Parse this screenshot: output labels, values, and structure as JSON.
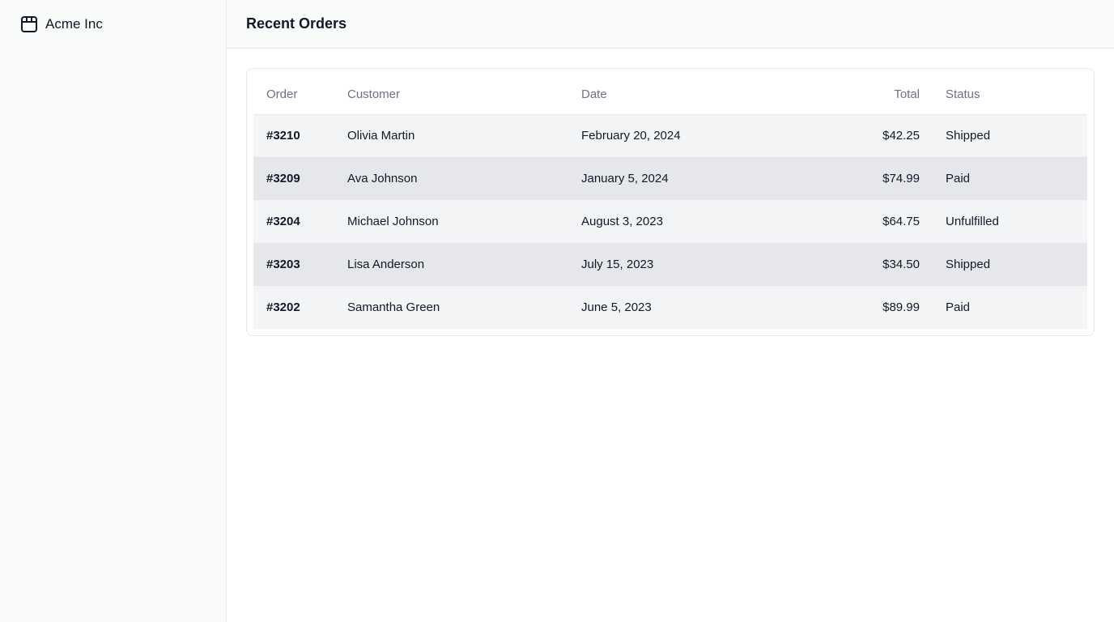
{
  "sidebar": {
    "brand": {
      "label": "Acme Inc",
      "icon": "package-icon"
    }
  },
  "header": {
    "title": "Recent Orders"
  },
  "orders_table": {
    "columns": {
      "order": "Order",
      "customer": "Customer",
      "date": "Date",
      "total": "Total",
      "status": "Status"
    },
    "rows": [
      {
        "order": "#3210",
        "customer": "Olivia Martin",
        "date": "February 20, 2024",
        "total": "$42.25",
        "status": "Shipped"
      },
      {
        "order": "#3209",
        "customer": "Ava Johnson",
        "date": "January 5, 2024",
        "total": "$74.99",
        "status": "Paid"
      },
      {
        "order": "#3204",
        "customer": "Michael Johnson",
        "date": "August 3, 2023",
        "total": "$64.75",
        "status": "Unfulfilled"
      },
      {
        "order": "#3203",
        "customer": "Lisa Anderson",
        "date": "July 15, 2023",
        "total": "$34.50",
        "status": "Shipped"
      },
      {
        "order": "#3202",
        "customer": "Samantha Green",
        "date": "June 5, 2023",
        "total": "$89.99",
        "status": "Paid"
      }
    ]
  }
}
